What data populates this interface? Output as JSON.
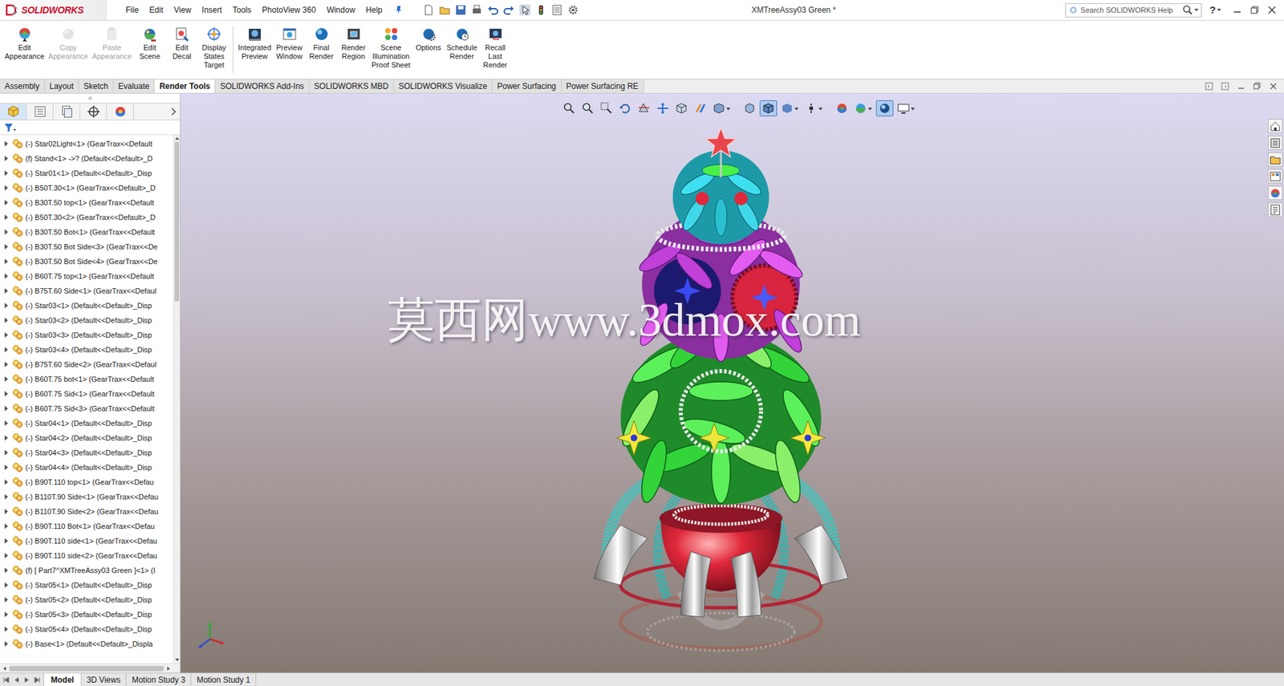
{
  "window": {
    "title": "XMTreeAssy03 Green *",
    "app": "SOLIDWORKS"
  },
  "menu": [
    "File",
    "Edit",
    "View",
    "Insert",
    "Tools",
    "PhotoView 360",
    "Window",
    "Help"
  ],
  "search": {
    "placeholder": "Search SOLIDWORKS Help"
  },
  "help": "?",
  "ribbon": {
    "groups": [
      [
        {
          "label": [
            "Edit",
            "Appearance"
          ],
          "disabled": false
        },
        {
          "label": [
            "Copy",
            "Appearance"
          ],
          "disabled": true
        },
        {
          "label": [
            "Paste",
            "Appearance"
          ],
          "disabled": true
        },
        {
          "label": [
            "Edit",
            "Scene"
          ],
          "disabled": false
        },
        {
          "label": [
            "Edit",
            "Decal"
          ],
          "disabled": false
        },
        {
          "label": [
            "Display",
            "States",
            "Target"
          ],
          "disabled": false
        }
      ],
      [
        {
          "label": [
            "Integrated",
            "Preview"
          ],
          "disabled": false
        },
        {
          "label": [
            "Preview",
            "Window"
          ],
          "disabled": false
        },
        {
          "label": [
            "Final",
            "Render"
          ],
          "disabled": false
        },
        {
          "label": [
            "Render",
            "Region"
          ],
          "disabled": false
        },
        {
          "label": [
            "Scene",
            "Illumination",
            "Proof Sheet"
          ],
          "disabled": false
        },
        {
          "label": [
            "Options"
          ],
          "disabled": false
        },
        {
          "label": [
            "Schedule",
            "Render"
          ],
          "disabled": false
        },
        {
          "label": [
            "Recall",
            "Last",
            "Render"
          ],
          "disabled": false
        }
      ]
    ]
  },
  "tabs": [
    {
      "label": "Assembly",
      "selected": false
    },
    {
      "label": "Layout",
      "selected": false
    },
    {
      "label": "Sketch",
      "selected": false
    },
    {
      "label": "Evaluate",
      "selected": false
    },
    {
      "label": "Render Tools",
      "selected": true
    },
    {
      "label": "SOLIDWORKS Add-Ins",
      "selected": false
    },
    {
      "label": "SOLIDWORKS MBD",
      "selected": false
    },
    {
      "label": "SOLIDWORKS Visualize",
      "selected": false
    },
    {
      "label": "Power Surfacing",
      "selected": false
    },
    {
      "label": "Power Surfacing RE",
      "selected": false
    }
  ],
  "feature_tree": {
    "panel_tabs": [
      {
        "selected": true
      },
      {
        "selected": false
      },
      {
        "selected": false
      },
      {
        "selected": false
      },
      {
        "selected": false
      }
    ],
    "scroll": {
      "level": 0.31
    },
    "items": [
      {
        "label": "(-) Star02Light<1> (GearTrax<<Default",
        "expanded": false
      },
      {
        "label": "(f) Stand<1> ->? (Default<<Default>_D",
        "expanded": false
      },
      {
        "label": "(-) Star01<1> (Default<<Default>_Disp",
        "expanded": false
      },
      {
        "label": "(-) B50T.30<1> (GearTrax<<Default>_D",
        "expanded": false
      },
      {
        "label": "(-) B30T.50 top<1> (GearTrax<<Default",
        "expanded": false
      },
      {
        "label": "(-) B50T.30<2> (GearTrax<<Default>_D",
        "expanded": false
      },
      {
        "label": "(-) B30T.50 Bot<1> (GearTrax<<Default",
        "expanded": false
      },
      {
        "label": "(-) B30T.50 Bot Side<3> (GearTrax<<De",
        "expanded": false
      },
      {
        "label": "(-) B30T.50 Bot Side<4> (GearTrax<<De",
        "expanded": false
      },
      {
        "label": "(-) B60T.75 top<1> (GearTrax<<Default",
        "expanded": false
      },
      {
        "label": "(-) B75T.60 Side<1> (GearTrax<<Defaul",
        "expanded": false
      },
      {
        "label": "(-) Star03<1> (Default<<Default>_Disp",
        "expanded": false
      },
      {
        "label": "(-) Star03<2> (Default<<Default>_Disp",
        "expanded": false
      },
      {
        "label": "(-) Star03<3> (Default<<Default>_Disp",
        "expanded": false
      },
      {
        "label": "(-) Star03<4> (Default<<Default>_Disp",
        "expanded": false
      },
      {
        "label": "(-) B75T.60 Side<2> (GearTrax<<Defaul",
        "expanded": false
      },
      {
        "label": "(-) B60T.75 bot<1> (GearTrax<<Default",
        "expanded": false
      },
      {
        "label": "(-) B60T.75 Sid<1> (GearTrax<<Default",
        "expanded": false
      },
      {
        "label": "(-) B60T.75 Sid<3> (GearTrax<<Default",
        "expanded": false
      },
      {
        "label": "(-) Star04<1> (Default<<Default>_Disp",
        "expanded": false
      },
      {
        "label": "(-) Star04<2> (Default<<Default>_Disp",
        "expanded": false
      },
      {
        "label": "(-) Star04<3> (Default<<Default>_Disp",
        "expanded": false
      },
      {
        "label": "(-) Star04<4> (Default<<Default>_Disp",
        "expanded": false
      },
      {
        "label": "(-) B90T.110 top<1> (GearTrax<<Defau",
        "expanded": false
      },
      {
        "label": "(-) B110T.90 Side<1> (GearTrax<<Defau",
        "expanded": false
      },
      {
        "label": "(-) B110T.90 Side<2> (GearTrax<<Defau",
        "expanded": false
      },
      {
        "label": "(-) B90T.110 Bot<1> (GearTrax<<Defau",
        "expanded": false
      },
      {
        "label": "(-) B90T.110 side<1> (GearTrax<<Defau",
        "expanded": false
      },
      {
        "label": "(-) B90T.110 side<2> (GearTrax<<Defau",
        "expanded": false
      },
      {
        "label": "(f) [ Part7^XMTreeAssy03 Green ]<1> (I",
        "expanded": false
      },
      {
        "label": "(-) Star05<1> (Default<<Default>_Disp",
        "expanded": false
      },
      {
        "label": "(-) Star05<2> (Default<<Default>_Disp",
        "expanded": false
      },
      {
        "label": "(-) Star05<3> (Default<<Default>_Disp",
        "expanded": false
      },
      {
        "label": "(-) Star05<4> (Default<<Default>_Disp",
        "expanded": false
      },
      {
        "label": "(-) Base<1> (Default<<Default>_Displa",
        "expanded": false
      }
    ]
  },
  "view_toolbar": [
    {
      "selected": false,
      "dropdown": false
    },
    {
      "selected": false,
      "dropdown": false
    },
    {
      "selected": false,
      "dropdown": false
    },
    {
      "selected": false,
      "dropdown": false
    },
    {
      "selected": false,
      "dropdown": false
    },
    {
      "selected": false,
      "dropdown": false
    },
    {
      "selected": false,
      "dropdown": false
    },
    {
      "selected": false,
      "dropdown": false
    },
    {
      "selected": false,
      "dropdown": true
    },
    {
      "selected": false,
      "dropdown": false
    },
    {
      "selected": true,
      "dropdown": false
    },
    {
      "selected": false,
      "dropdown": true
    },
    {
      "selected": false,
      "dropdown": true
    },
    {
      "selected": false,
      "dropdown": false
    },
    {
      "selected": false,
      "dropdown": true
    },
    {
      "selected": true,
      "dropdown": false
    },
    {
      "selected": false,
      "dropdown": true
    }
  ],
  "watermark": "莫西网www.3dmox.com",
  "bottom_tabs": [
    {
      "label": "Model",
      "selected": true
    },
    {
      "label": "3D Views",
      "selected": false
    },
    {
      "label": "Motion Study 3",
      "selected": false
    },
    {
      "label": "Motion Study 1",
      "selected": false
    }
  ]
}
